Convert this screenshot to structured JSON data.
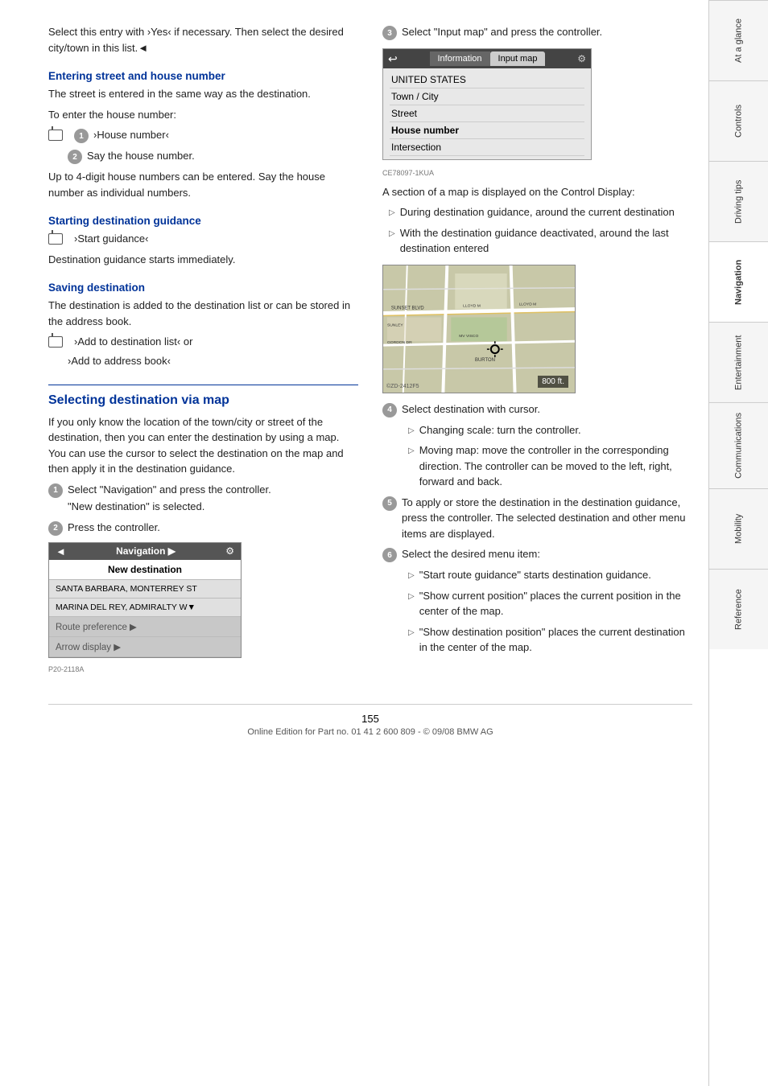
{
  "page": {
    "number": "155",
    "footer_text": "Online Edition for Part no. 01 41 2 600 809 - © 09/08 BMW AG"
  },
  "sidebar": {
    "tabs": [
      {
        "label": "At a glance",
        "active": false
      },
      {
        "label": "Controls",
        "active": false
      },
      {
        "label": "Driving tips",
        "active": false
      },
      {
        "label": "Navigation",
        "active": true
      },
      {
        "label": "Entertainment",
        "active": false
      },
      {
        "label": "Communications",
        "active": false
      },
      {
        "label": "Mobility",
        "active": false
      },
      {
        "label": "Reference",
        "active": false
      }
    ]
  },
  "left_col": {
    "intro": "Select this entry with ›Yes‹ if necessary. Then select the desired city/town in this list.◄",
    "sections": {
      "entering_street": {
        "heading": "Entering street and house number",
        "para1": "The street is entered in the same way as the destination.",
        "para2": "To enter the house number:",
        "step1": "›House number‹",
        "step2": "Say the house number.",
        "para3": "Up to 4-digit house numbers can be entered. Say the house number as individual numbers."
      },
      "starting_guidance": {
        "heading": "Starting destination guidance",
        "step1": "›Start guidance‹",
        "para1": "Destination guidance starts immediately."
      },
      "saving_destination": {
        "heading": "Saving destination",
        "para1": "The destination is added to the destination list or can be stored in the address book.",
        "option1": "›Add to destination list‹ or",
        "option2": "›Add to address book‹"
      }
    },
    "selecting_via_map": {
      "heading": "Selecting destination via map",
      "intro": "If you only know the location of the town/city or street of the destination, then you can enter the destination by using a map. You can use the cursor to select the destination on the map and then apply it in the destination guidance.",
      "steps": [
        {
          "num": "1",
          "text": "Select \"Navigation\" and press the controller.",
          "sub": "\"New destination\" is selected."
        },
        {
          "num": "2",
          "text": "Press the controller."
        }
      ]
    },
    "nav_ui": {
      "header_left": "◄",
      "header_title": "Navigation ▶",
      "header_icon": "⚙",
      "row1": "New destination",
      "row2": "SANTA BARBARA, MONTERREY ST",
      "row3": "MARINA DEL REY, ADMIRALTY W▼",
      "row4": "Route preference ▶",
      "row5": "Arrow display ▶"
    }
  },
  "right_col": {
    "step3": {
      "num": "3",
      "text": "Select \"Input map\" and press the controller."
    },
    "input_map_ui": {
      "back_btn": "↩",
      "tab_info": "Information",
      "tab_map": "Input map",
      "row1": "UNITED STATES",
      "row2": "Town / City",
      "row3": "Street",
      "row4": "House number",
      "row5": "Intersection"
    },
    "map_description": "A section of a map is displayed on the Control Display:",
    "map_bullets": [
      "During destination guidance, around the current destination",
      "With the destination guidance deactivated, around the last destination entered"
    ],
    "map_distance": "800 ft.",
    "steps_4_6": [
      {
        "num": "4",
        "text": "Select destination with cursor.",
        "bullets": [
          "Changing scale: turn the controller.",
          "Moving map: move the controller in the corresponding direction. The controller can be moved to the left, right, forward and back."
        ]
      },
      {
        "num": "5",
        "text": "To apply or store the destination in the destination guidance, press the controller. The selected destination and other menu items are displayed."
      },
      {
        "num": "6",
        "text": "Select the desired menu item:",
        "bullets": [
          "\"Start route guidance\" starts destination guidance.",
          "\"Show current position\" places the current position in the center of the map.",
          "\"Show destination position\" places the current destination in the center of the map."
        ]
      }
    ]
  }
}
